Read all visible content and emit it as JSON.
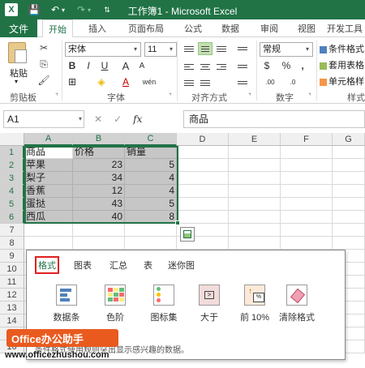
{
  "titlebar": {
    "title": "工作簿1 - Microsoft Excel",
    "logo_text": "X",
    "save_icon": "💾",
    "undo_icon": "↶",
    "redo_icon": "↷",
    "dropdown_glyph": "▾",
    "qat_more": "⇅"
  },
  "tabs": {
    "file": "文件",
    "items": [
      "开始",
      "插入",
      "页面布局",
      "公式",
      "数据",
      "审阅",
      "视图",
      "开发工具"
    ]
  },
  "ribbon": {
    "clipboard": {
      "paste": "粘贴",
      "label": "剪贴板",
      "cut_icon": "✂",
      "copy_icon": "⎘",
      "painter_icon": "🖌"
    },
    "font": {
      "name": "宋体",
      "size": "11",
      "label": "字体",
      "bold": "B",
      "italic": "I",
      "underline": "U",
      "grow": "A",
      "shrink": "A",
      "border": "⊞",
      "fill": "◈",
      "fontcolor": "A",
      "wen": "wén"
    },
    "alignment": {
      "label": "对齐方式"
    },
    "number": {
      "format": "常规",
      "label": "数字",
      "currency": "$",
      "percent": "%",
      "comma": ",",
      "inc": ".00",
      "dec": ".0"
    },
    "styles": {
      "conditional": "条件格式",
      "table": "套用表格",
      "cell": "单元格样",
      "label": "样式"
    },
    "launcher_glyph": "⌝"
  },
  "formula_bar": {
    "namebox": "A1",
    "cancel": "✕",
    "enter": "✓",
    "fx": "fx",
    "content": "商品"
  },
  "grid": {
    "columns": [
      "A",
      "B",
      "C",
      "D",
      "E",
      "F",
      "G"
    ],
    "rows": [
      "1",
      "2",
      "3",
      "4",
      "5",
      "6",
      "7",
      "8",
      "9",
      "10",
      "11",
      "12",
      "13",
      "14",
      "15",
      "16"
    ],
    "data": [
      [
        "商品",
        "价格",
        "销量"
      ],
      [
        "苹果",
        "23",
        "5"
      ],
      [
        "梨子",
        "34",
        "4"
      ],
      [
        "香蕉",
        "12",
        "4"
      ],
      [
        "蛋挞",
        "43",
        "5"
      ],
      [
        "西瓜",
        "40",
        "8"
      ]
    ]
  },
  "quick_analysis": {
    "tabs": [
      "格式",
      "图表",
      "汇总",
      "表",
      "迷你图"
    ],
    "items": [
      "数据条",
      "色阶",
      "图标集",
      "大于",
      "前 10%",
      "清除格式"
    ],
    "gt_symbol": ">",
    "pct_symbol": "%",
    "top_arrow": "↑",
    "description": "条件格式使用规则突出显示感兴趣的数据。"
  },
  "watermark": {
    "badge": "Office办公助手",
    "url": "www.officezhushou.com"
  }
}
